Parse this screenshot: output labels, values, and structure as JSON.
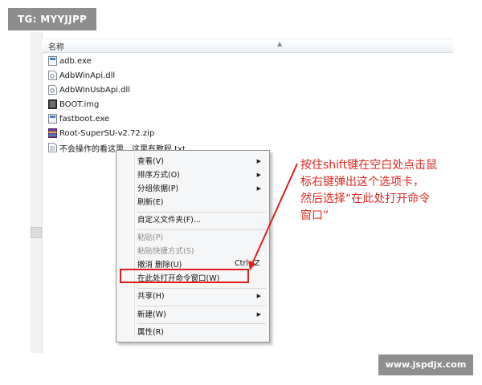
{
  "overlay": {
    "tg_badge": "TG: MYYJJPP",
    "watermark": "www.jspdjx.com"
  },
  "explorer": {
    "column_header": "名称",
    "files": [
      {
        "name": "adb.exe",
        "icon": "exe-file-icon"
      },
      {
        "name": "AdbWinApi.dll",
        "icon": "dll-file-icon"
      },
      {
        "name": "AdbWinUsbApi.dll",
        "icon": "dll-file-icon"
      },
      {
        "name": "BOOT.img",
        "icon": "img-file-icon"
      },
      {
        "name": "fastboot.exe",
        "icon": "exe-file-icon"
      },
      {
        "name": "Root-SuperSU-v2.72.zip",
        "icon": "zip-file-icon"
      },
      {
        "name": "不会操作的看这里，这里有教程.txt",
        "icon": "txt-file-icon"
      }
    ]
  },
  "context_menu": {
    "view": "查看(V)",
    "sort_by": "排序方式(O)",
    "group_by": "分组依据(P)",
    "refresh": "刷新(E)",
    "customize_folder": "自定义文件夹(F)...",
    "paste": "粘贴(P)",
    "paste_shortcut": "粘贴快捷方式(S)",
    "undo_delete": "撤消 删除(U)",
    "undo_shortcut": "Ctrl+Z",
    "open_cmd_here": "在此处打开命令窗口(W)",
    "share": "共享(H)",
    "new": "新建(W)",
    "properties": "属性(R)"
  },
  "annotation": {
    "line1": "按住shift键在空白处点击鼠",
    "line2": "标右键弹出这个选项卡，",
    "line3": "然后选择“在此处打开命令",
    "line4": "窗口”"
  },
  "colors": {
    "annotation_red": "#e0281f",
    "highlight_red": "#e01d1d",
    "overlay_gray": "#8e8e8e"
  }
}
